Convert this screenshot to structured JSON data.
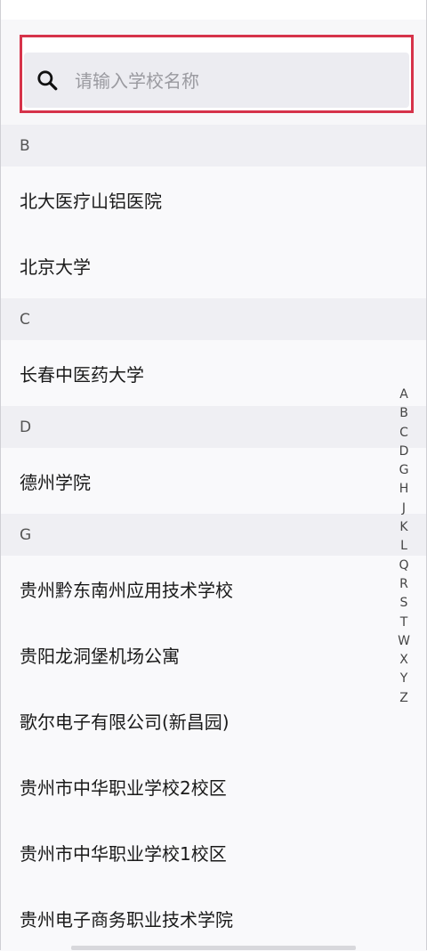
{
  "search": {
    "placeholder": "请输入学校名称",
    "value": ""
  },
  "sections": [
    {
      "letter": "B",
      "items": [
        "北大医疗山铝医院",
        "北京大学"
      ]
    },
    {
      "letter": "C",
      "items": [
        "长春中医药大学"
      ]
    },
    {
      "letter": "D",
      "items": [
        "德州学院"
      ]
    },
    {
      "letter": "G",
      "items": [
        "贵州黔东南州应用技术学校",
        "贵阳龙洞堡机场公寓",
        "歌尔电子有限公司(新昌园)",
        "贵州市中华职业学校2校区",
        "贵州市中华职业学校1校区",
        "贵州电子商务职业技术学院"
      ]
    }
  ],
  "index_letters": [
    "A",
    "B",
    "C",
    "D",
    "G",
    "H",
    "J",
    "K",
    "L",
    "Q",
    "R",
    "S",
    "T",
    "W",
    "X",
    "Y",
    "Z"
  ],
  "colors": {
    "highlight_border": "#d6334a",
    "search_bg": "#ececf1",
    "section_bg": "#efeff3"
  }
}
